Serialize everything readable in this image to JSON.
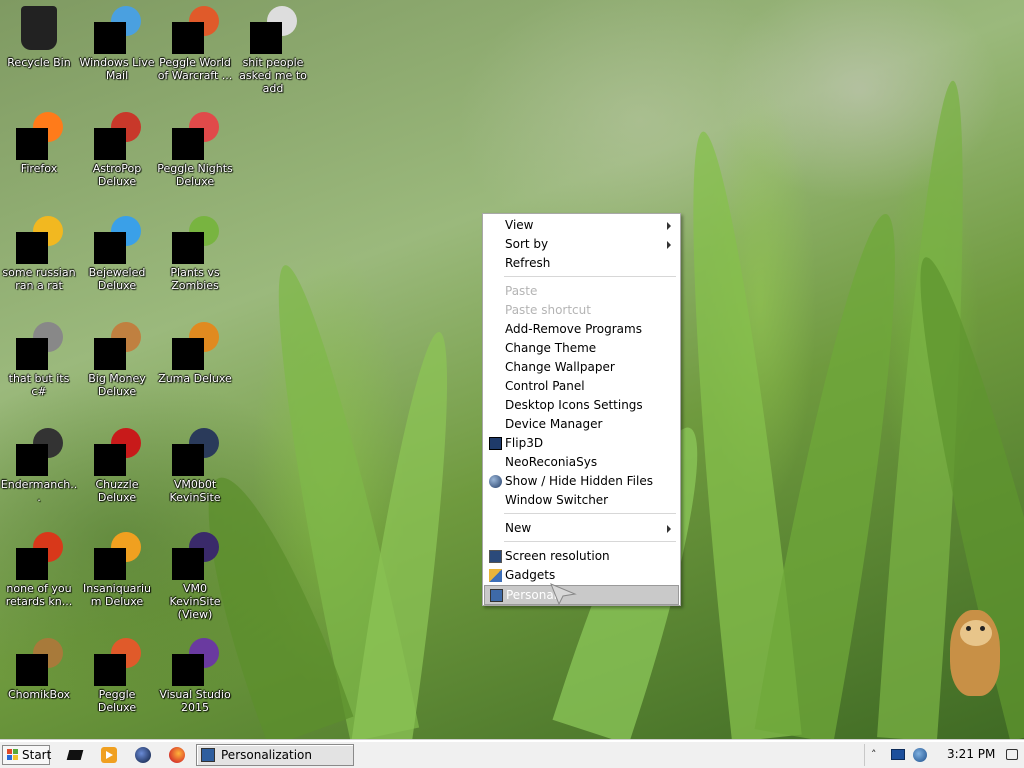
{
  "desktop": {
    "icons": [
      {
        "label": "Recycle Bin",
        "icon": "recycle-bin-icon"
      },
      {
        "label": "Windows Live Mail",
        "icon": "windows-live-mail-icon"
      },
      {
        "label": "Peggle World of Warcraft ...",
        "icon": "peggle-wow-icon"
      },
      {
        "label": "shit people asked me to add",
        "icon": "folder-icon"
      },
      {
        "label": "Firefox",
        "icon": "firefox-icon"
      },
      {
        "label": "AstroPop Deluxe",
        "icon": "astropop-icon"
      },
      {
        "label": "Peggle Nights Deluxe",
        "icon": "peggle-nights-icon"
      },
      {
        "label": "some russian ran a rat",
        "icon": "russian-app-icon"
      },
      {
        "label": "Bejeweled Deluxe",
        "icon": "bejeweled-icon"
      },
      {
        "label": "Plants vs Zombies",
        "icon": "plants-vs-zombies-icon"
      },
      {
        "label": "that but its c#",
        "icon": "shortcut-icon"
      },
      {
        "label": "Big Money Deluxe",
        "icon": "big-money-icon"
      },
      {
        "label": "Zuma Deluxe",
        "icon": "zuma-icon"
      },
      {
        "label": "Endermanch...",
        "icon": "endermanch-icon"
      },
      {
        "label": "Chuzzle Deluxe",
        "icon": "chuzzle-icon"
      },
      {
        "label": "VM0b0t KevinSite",
        "icon": "vm0b0t-icon"
      },
      {
        "label": "none of you retards kn...",
        "icon": "chrome-like-icon"
      },
      {
        "label": "Insaniquarium Deluxe",
        "icon": "insaniquarium-icon"
      },
      {
        "label": "VM0 KevinSite (View)",
        "icon": "vm0-view-icon"
      },
      {
        "label": "ChomikBox",
        "icon": "chomikbox-icon"
      },
      {
        "label": "Peggle Deluxe",
        "icon": "peggle-deluxe-icon"
      },
      {
        "label": "Visual Studio 2015",
        "icon": "visual-studio-icon"
      }
    ]
  },
  "context_menu": {
    "view": "View",
    "sort_by": "Sort by",
    "refresh": "Refresh",
    "paste": "Paste",
    "paste_shortcut": "Paste shortcut",
    "add_remove_programs": "Add-Remove Programs",
    "change_theme": "Change Theme",
    "change_wallpaper": "Change Wallpaper",
    "control_panel": "Control Panel",
    "desktop_icons_settings": "Desktop Icons Settings",
    "device_manager": "Device Manager",
    "flip3d": "Flip3D",
    "neoreconiasys": "NeoReconiaSys",
    "show_hide_hidden": "Show / Hide Hidden Files",
    "window_switcher": "Window Switcher",
    "new": "New",
    "screen_resolution": "Screen resolution",
    "gadgets": "Gadgets",
    "personalize": "Personali"
  },
  "taskbar": {
    "start_label": "Start",
    "task_label": "Personalization",
    "clock": "3:21 PM"
  },
  "colors": {
    "menu_highlight": "#c9c9c9",
    "disabled_text": "#b4b4b4",
    "taskbar_bg": "#f0f0f0"
  }
}
